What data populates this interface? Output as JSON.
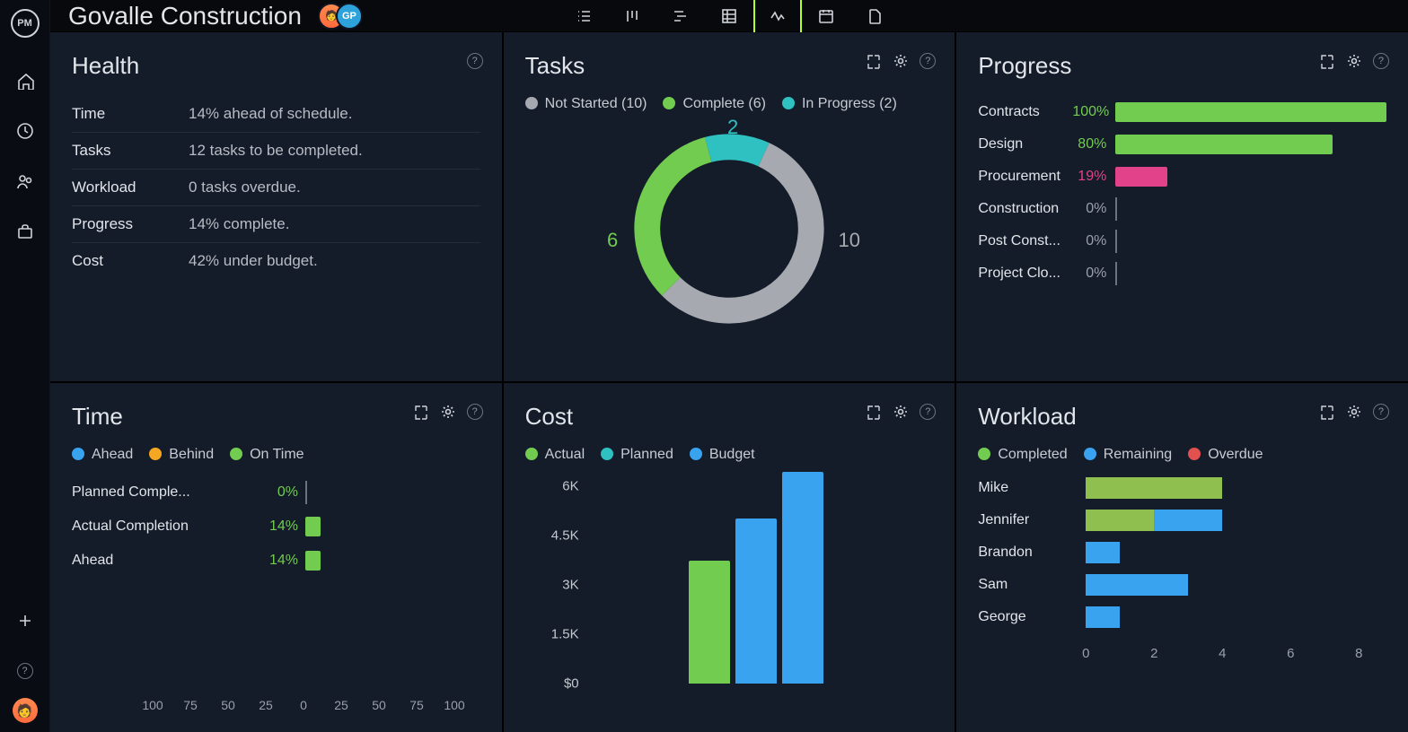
{
  "app": {
    "logo": "PM",
    "title": "Govalle Construction",
    "avatar2": "GP"
  },
  "sidebar": {
    "home": "home-icon",
    "recent": "clock-icon",
    "people": "people-icon",
    "briefcase": "briefcase-icon",
    "add": "plus-icon",
    "help": "help-icon"
  },
  "viewtabs": [
    "list",
    "board",
    "gantt",
    "sheet",
    "dashboard",
    "calendar",
    "file"
  ],
  "health": {
    "title": "Health",
    "rows": [
      {
        "k": "Time",
        "v": "14% ahead of schedule."
      },
      {
        "k": "Tasks",
        "v": "12 tasks to be completed."
      },
      {
        "k": "Workload",
        "v": "0 tasks overdue."
      },
      {
        "k": "Progress",
        "v": "14% complete."
      },
      {
        "k": "Cost",
        "v": "42% under budget."
      }
    ]
  },
  "tasks": {
    "title": "Tasks",
    "legend": [
      {
        "label": "Not Started (10)",
        "color": "#a6aab0",
        "short": "10"
      },
      {
        "label": "Complete (6)",
        "color": "#72cc50",
        "short": "6"
      },
      {
        "label": "In Progress (2)",
        "color": "#2fc1c1",
        "short": "2"
      }
    ]
  },
  "progress": {
    "title": "Progress",
    "rows": [
      {
        "k": "Contracts",
        "v": "100%",
        "pct": 100,
        "color": "#72cc50",
        "vc": "#72cc50"
      },
      {
        "k": "Design",
        "v": "80%",
        "pct": 80,
        "color": "#72cc50",
        "vc": "#72cc50"
      },
      {
        "k": "Procurement",
        "v": "19%",
        "pct": 19,
        "color": "#e2428a",
        "vc": "#e2428a"
      },
      {
        "k": "Construction",
        "v": "0%",
        "pct": 0,
        "color": "#72cc50",
        "vc": "#9aa0ab"
      },
      {
        "k": "Post Const...",
        "v": "0%",
        "pct": 0,
        "color": "#72cc50",
        "vc": "#9aa0ab"
      },
      {
        "k": "Project Clo...",
        "v": "0%",
        "pct": 0,
        "color": "#72cc50",
        "vc": "#9aa0ab"
      }
    ]
  },
  "time": {
    "title": "Time",
    "legend": [
      {
        "label": "Ahead",
        "color": "#39a3f0"
      },
      {
        "label": "Behind",
        "color": "#f5a623"
      },
      {
        "label": "On Time",
        "color": "#72cc50"
      }
    ],
    "rows": [
      {
        "k": "Planned Comple...",
        "v": "0%",
        "pct": 0,
        "color": "#72cc50"
      },
      {
        "k": "Actual Completion",
        "v": "14%",
        "pct": 14,
        "color": "#72cc50"
      },
      {
        "k": "Ahead",
        "v": "14%",
        "pct": 14,
        "color": "#72cc50"
      }
    ],
    "axis": [
      "100",
      "75",
      "50",
      "25",
      "0",
      "25",
      "50",
      "75",
      "100"
    ]
  },
  "cost": {
    "title": "Cost",
    "legend": [
      {
        "label": "Actual",
        "color": "#72cc50"
      },
      {
        "label": "Planned",
        "color": "#2fc1c1"
      },
      {
        "label": "Budget",
        "color": "#39a3f0"
      }
    ],
    "ylabels": [
      "6K",
      "4.5K",
      "3K",
      "1.5K",
      "$0"
    ]
  },
  "workload": {
    "title": "Workload",
    "legend": [
      {
        "label": "Completed",
        "color": "#72cc50"
      },
      {
        "label": "Remaining",
        "color": "#39a3f0"
      },
      {
        "label": "Overdue",
        "color": "#e25050"
      }
    ],
    "rows": [
      {
        "k": "Mike",
        "segs": [
          {
            "c": "#8fbf4f",
            "w": 4
          }
        ]
      },
      {
        "k": "Jennifer",
        "segs": [
          {
            "c": "#8fbf4f",
            "w": 2
          },
          {
            "c": "#39a3f0",
            "w": 2
          }
        ]
      },
      {
        "k": "Brandon",
        "segs": [
          {
            "c": "#39a3f0",
            "w": 1
          }
        ]
      },
      {
        "k": "Sam",
        "segs": [
          {
            "c": "#39a3f0",
            "w": 3
          }
        ]
      },
      {
        "k": "George",
        "segs": [
          {
            "c": "#39a3f0",
            "w": 1
          }
        ]
      }
    ],
    "axis": [
      "0",
      "2",
      "4",
      "6",
      "8"
    ]
  },
  "chart_data": [
    {
      "type": "pie",
      "title": "Tasks",
      "series": [
        {
          "name": "Not Started",
          "value": 10
        },
        {
          "name": "Complete",
          "value": 6
        },
        {
          "name": "In Progress",
          "value": 2
        }
      ]
    },
    {
      "type": "bar",
      "title": "Progress",
      "categories": [
        "Contracts",
        "Design",
        "Procurement",
        "Construction",
        "Post Construction",
        "Project Closure"
      ],
      "values": [
        100,
        80,
        19,
        0,
        0,
        0
      ],
      "ylabel": "%",
      "ylim": [
        0,
        100
      ]
    },
    {
      "type": "bar",
      "title": "Time",
      "categories": [
        "Planned Completion",
        "Actual Completion",
        "Ahead"
      ],
      "values": [
        0,
        14,
        14
      ],
      "ylabel": "%",
      "ylim": [
        -100,
        100
      ]
    },
    {
      "type": "bar",
      "title": "Cost",
      "categories": [
        "Actual",
        "Planned",
        "Budget"
      ],
      "values": [
        3500,
        4700,
        6000
      ],
      "ylabel": "$",
      "ylim": [
        0,
        6000
      ]
    },
    {
      "type": "bar",
      "title": "Workload",
      "categories": [
        "Mike",
        "Jennifer",
        "Brandon",
        "Sam",
        "George"
      ],
      "series": [
        {
          "name": "Completed",
          "values": [
            4,
            2,
            0,
            0,
            0
          ]
        },
        {
          "name": "Remaining",
          "values": [
            0,
            2,
            1,
            3,
            1
          ]
        },
        {
          "name": "Overdue",
          "values": [
            0,
            0,
            0,
            0,
            0
          ]
        }
      ],
      "xlim": [
        0,
        8
      ]
    }
  ]
}
